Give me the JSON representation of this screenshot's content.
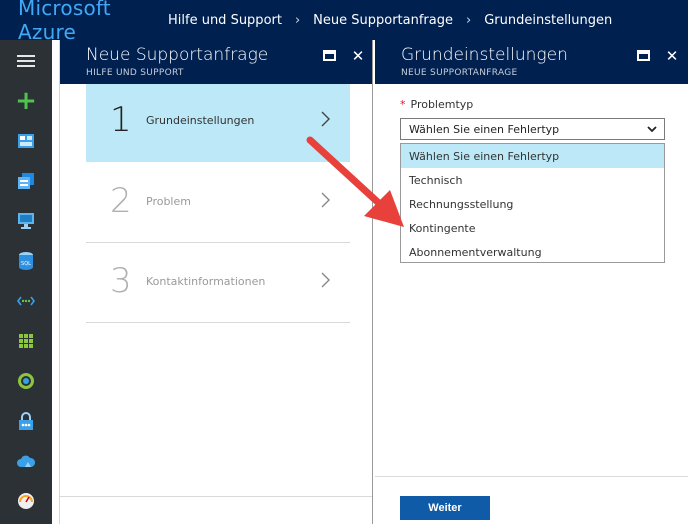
{
  "topbar": {
    "brand": "Microsoft Azure",
    "breadcrumbs": [
      "Hilfe und Support",
      "Neue Supportanfrage",
      "Grundeinstellungen"
    ]
  },
  "rail": {
    "icons": [
      "menu-icon",
      "add-icon",
      "dashboard-icon",
      "resource-groups-icon",
      "virtual-machines-icon",
      "sql-database-icon",
      "virtual-network-icon",
      "all-resources-icon",
      "app-service-icon",
      "security-icon",
      "cloud-services-icon",
      "advisor-icon"
    ]
  },
  "blade1": {
    "title": "Neue Supportanfrage",
    "subtitle": "HILFE UND SUPPORT",
    "steps": [
      {
        "num": "1",
        "label": "Grundeinstellungen"
      },
      {
        "num": "2",
        "label": "Problem"
      },
      {
        "num": "3",
        "label": "Kontaktinformationen"
      }
    ]
  },
  "blade2": {
    "title": "Grundeinstellungen",
    "subtitle": "NEUE SUPPORTANFRAGE",
    "field": {
      "required_mark": "*",
      "label": "Problemtyp",
      "value": "Wählen Sie einen Fehlertyp",
      "options": [
        "Wählen Sie einen Fehlertyp",
        "Technisch",
        "Rechnungsstellung",
        "Kontingente",
        "Abonnementverwaltung"
      ]
    },
    "next_label": "Weiter"
  },
  "colors": {
    "topbar": "#002050",
    "brand": "#3fa9f5",
    "rail": "#2b3135",
    "selected": "#bce8f7",
    "button": "#0f5ba7",
    "arrow": "#e8413c",
    "required": "#e81123"
  }
}
